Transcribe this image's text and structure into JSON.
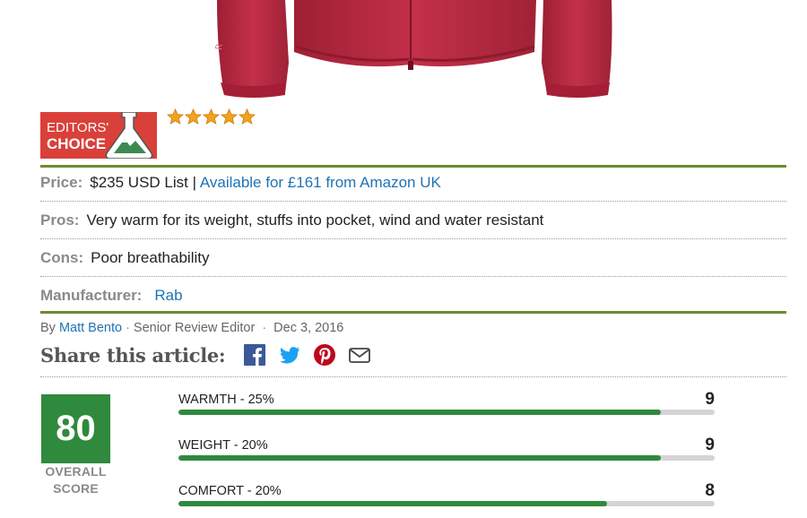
{
  "badge": {
    "line1": "EDITORS'",
    "line2": "CHOICE"
  },
  "rating": {
    "stars": 5,
    "max": 5
  },
  "specs": {
    "price": {
      "label": "Price:",
      "value": "$235 USD List",
      "separator": "|",
      "link": "Available for £161 from Amazon UK"
    },
    "pros": {
      "label": "Pros:",
      "value": "Very warm for its weight, stuffs into pocket, wind and water resistant"
    },
    "cons": {
      "label": "Cons:",
      "value": "Poor breathability"
    },
    "manufacturer": {
      "label": "Manufacturer:",
      "value": "Rab"
    }
  },
  "byline": {
    "prefix": "By",
    "author": "Matt Bento",
    "role": "Senior Review Editor",
    "date": "Dec 3, 2016",
    "dot": "·"
  },
  "share": {
    "label": "Share this article:",
    "icons": [
      "facebook-icon",
      "twitter-icon",
      "pinterest-icon",
      "email-icon"
    ]
  },
  "overall": {
    "score": "80",
    "label_line1": "OVERALL",
    "label_line2": "SCORE"
  },
  "metrics": [
    {
      "name": "WARMTH - 25%",
      "score": "9",
      "fill_fraction": 0.9
    },
    {
      "name": "WEIGHT - 20%",
      "score": "9",
      "fill_fraction": 0.9
    },
    {
      "name": "COMFORT - 20%",
      "score": "8",
      "fill_fraction": 0.8
    }
  ],
  "colors": {
    "green_rule": "#6f8a2f",
    "score_green": "#2f8a3d",
    "link_blue": "#1e73b5",
    "badge_red": "#d9403a",
    "star_gold": "#f3a21b",
    "jacket_red": "#b8273d"
  }
}
